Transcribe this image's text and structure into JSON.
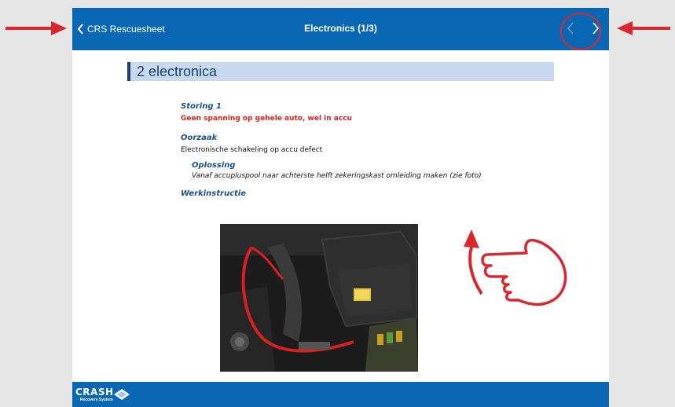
{
  "navbar": {
    "back_label": "CRS Rescuesheet",
    "title": "Electronics (1/3)"
  },
  "section": {
    "title": "2 electronica"
  },
  "document": {
    "storing_heading": "Storing 1",
    "storing_text": "Geen spanning op gehele auto, wel in accu",
    "oorzaak_heading": "Oorzaak",
    "oorzaak_text": "Electronische schakeling op accu defect",
    "oplossing_heading": "Oplossing",
    "oplossing_text": "Vanaf accupluspool  naar achterste helft zekeringskast omleiding maken (zie foto)",
    "werkinstructie_heading": "Werkinstructie"
  },
  "footer": {
    "logo_word": "CRASH",
    "logo_sub": "Recovery System"
  },
  "colors": {
    "navbar": "#0a67b3",
    "annotation": "#d8282e",
    "section_header_bg": "#c8d9ef",
    "heading_blue": "#1f4e82",
    "warning_red": "#e02020"
  },
  "icons": {
    "back": "chevron-left-icon",
    "prev": "chevron-left-icon",
    "next": "chevron-right-icon"
  }
}
